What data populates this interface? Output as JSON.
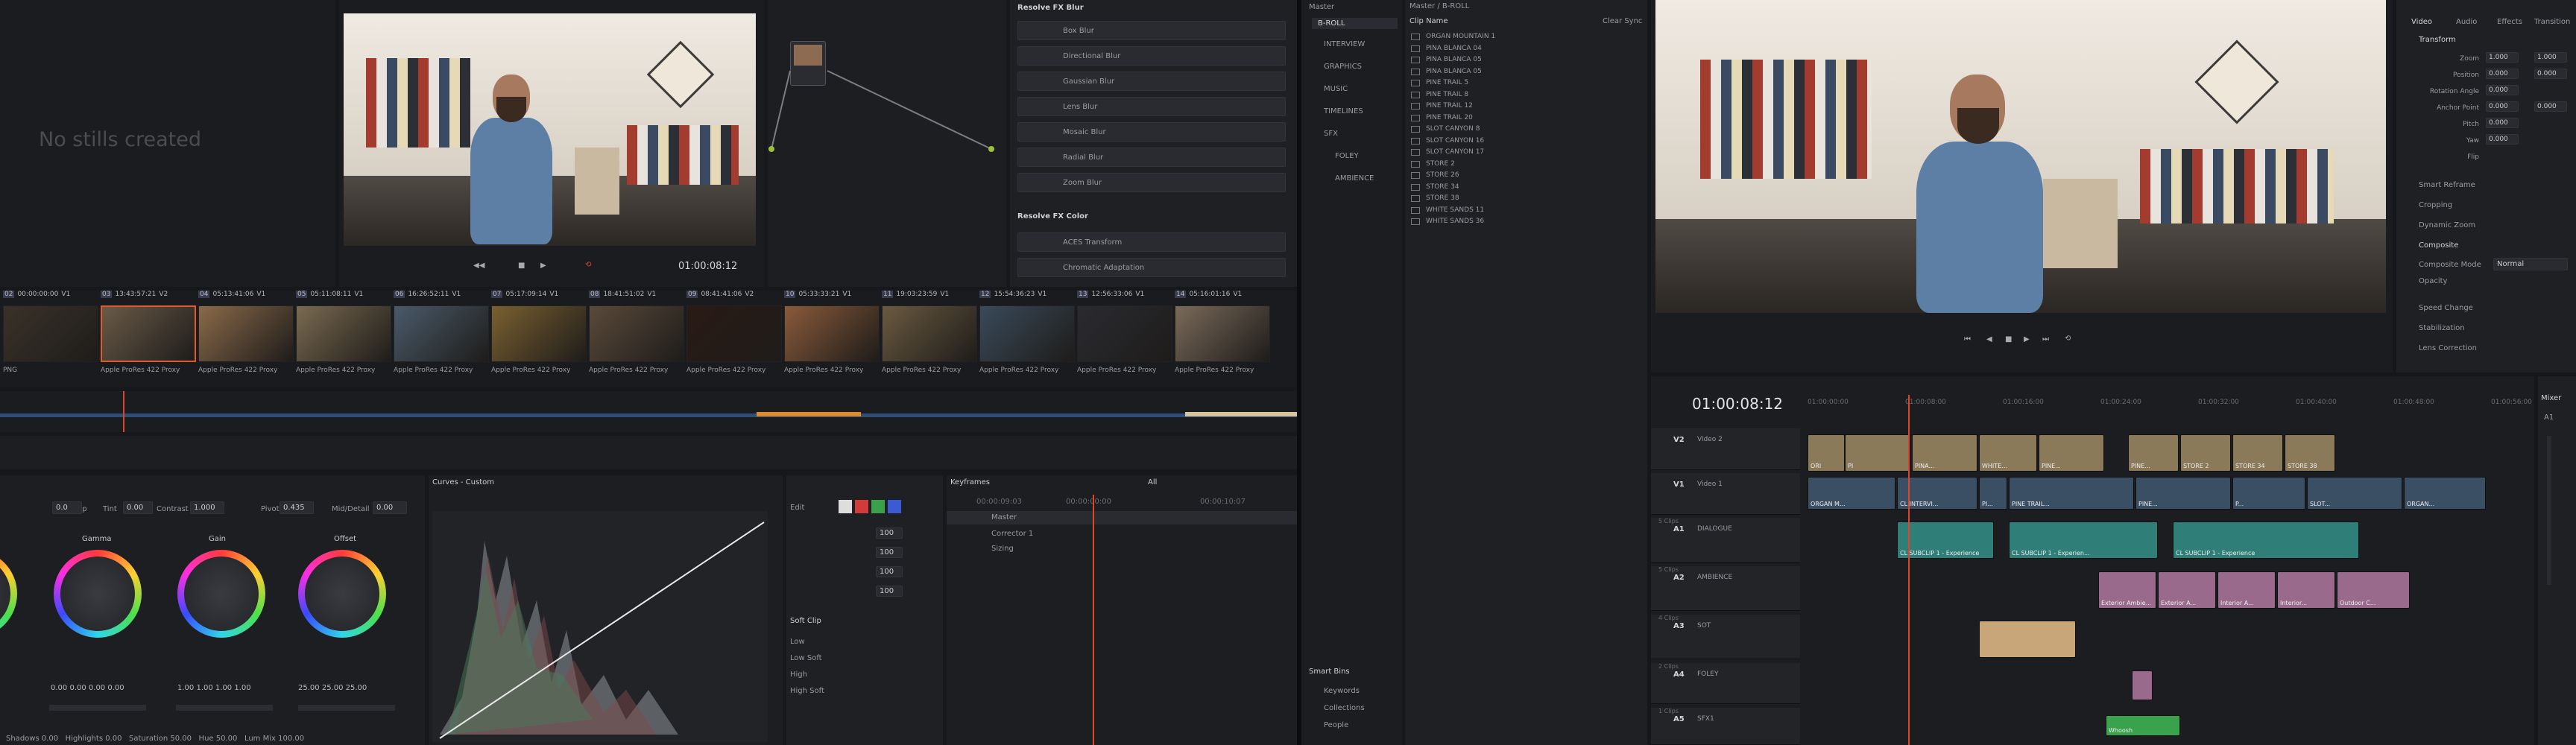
{
  "gallery": {
    "empty_text": "No stills created"
  },
  "color_viewer": {
    "timecode": "01:00:08:12"
  },
  "fx_library": {
    "blur_header": "Resolve FX Blur",
    "blur_items": [
      "Box Blur",
      "Directional Blur",
      "Gaussian Blur",
      "Lens Blur",
      "Mosaic Blur",
      "Radial Blur",
      "Zoom Blur"
    ],
    "color_header": "Resolve FX Color",
    "color_items": [
      "ACES Transform",
      "Chromatic Adaptation"
    ]
  },
  "clips_strip": {
    "clips": [
      {
        "num": "02",
        "tc": "00:00:00:00",
        "name": "PNG",
        "track": "V1"
      },
      {
        "num": "03",
        "tc": "13:43:57:21",
        "name": "Apple ProRes 422 Proxy",
        "track": "V2"
      },
      {
        "num": "04",
        "tc": "05:13:41:06",
        "name": "Apple ProRes 422 Proxy",
        "track": "V1"
      },
      {
        "num": "05",
        "tc": "05:11:08:11",
        "name": "Apple ProRes 422 Proxy",
        "track": "V1"
      },
      {
        "num": "06",
        "tc": "16:26:52:11",
        "name": "Apple ProRes 422 Proxy",
        "track": "V1"
      },
      {
        "num": "07",
        "tc": "05:17:09:14",
        "name": "Apple ProRes 422 Proxy",
        "track": "V1"
      },
      {
        "num": "08",
        "tc": "18:41:51:02",
        "name": "Apple ProRes 422 Proxy",
        "track": "V1"
      },
      {
        "num": "09",
        "tc": "08:41:41:06",
        "name": "Apple ProRes 422 Proxy",
        "track": "V2"
      },
      {
        "num": "10",
        "tc": "05:33:33:21",
        "name": "Apple ProRes 422 Proxy",
        "track": "V1"
      },
      {
        "num": "11",
        "tc": "19:03:23:59",
        "name": "Apple ProRes 422 Proxy",
        "track": "V1"
      },
      {
        "num": "12",
        "tc": "15:54:36:23",
        "name": "Apple ProRes 422 Proxy",
        "track": "V1"
      },
      {
        "num": "13",
        "tc": "12:56:33:06",
        "name": "Apple ProRes 422 Proxy",
        "track": "V1"
      },
      {
        "num": "14",
        "tc": "05:16:01:16",
        "name": "Apple ProRes 422 Proxy",
        "track": "V1"
      }
    ]
  },
  "primaries": {
    "temp_label": "Temp",
    "temp_val": "0.0",
    "tint_label": "Tint",
    "tint_val": "0.00",
    "contrast_label": "Contrast",
    "contrast_val": "1.000",
    "pivot_label": "Pivot",
    "pivot_val": "0.435",
    "middetail_label": "Mid/Detail",
    "middetail_val": "0.00",
    "wheels": [
      {
        "name": "Gamma",
        "values": [
          "0.00",
          "0.00",
          "0.00",
          "0.00"
        ]
      },
      {
        "name": "Gain",
        "values": [
          "1.00",
          "1.00",
          "1.00",
          "1.00"
        ]
      },
      {
        "name": "Offset",
        "values": [
          "25.00",
          "25.00",
          "25.00"
        ]
      }
    ],
    "bottom": {
      "shadows_label": "Shadows",
      "shadows_val": "0.00",
      "highlights_label": "Highlights",
      "highlights_val": "0.00",
      "saturation_label": "Saturation",
      "saturation_val": "50.00",
      "hue_label": "Hue",
      "hue_val": "50.00",
      "lummix_label": "Lum Mix",
      "lummix_val": "100.00"
    }
  },
  "curves": {
    "title": "Curves - Custom"
  },
  "curve_edit": {
    "label": "Edit",
    "values": [
      "100",
      "100",
      "100",
      "100"
    ],
    "softclip_label": "Soft Clip",
    "softclip_items": [
      "Low",
      "Low Soft",
      "High",
      "High Soft"
    ]
  },
  "keyframes": {
    "title": "Keyframes",
    "filter": "All",
    "tc_left": "00:00:09:03",
    "tc_mid": "00:00:00:00",
    "tc_right": "00:00:10:07",
    "rows": [
      "Master",
      "Corrector 1",
      "Sizing"
    ]
  },
  "media_pool": {
    "root": "Master",
    "bins": [
      "B-ROLL",
      "INTERVIEW",
      "GRAPHICS",
      "MUSIC",
      "TIMELINES",
      "SFX",
      "FOLEY",
      "AMBIENCE"
    ],
    "path": "Master / B-ROLL",
    "column_header": "Clip Name",
    "sort_label": "Clear Sync",
    "clips": [
      "ORGAN MOUNTAIN 1",
      "PINA BLANCA 04",
      "PINA BLANCA 05",
      "PINA BLANCA 05",
      "PINE TRAIL 5",
      "PINE TRAIL 8",
      "PINE TRAIL 12",
      "PINE TRAIL 20",
      "SLOT CANYON 8",
      "SLOT CANYON 16",
      "SLOT CANYON 17",
      "STORE 2",
      "STORE 26",
      "STORE 34",
      "STORE 38",
      "WHITE SANDS 11",
      "WHITE SANDS 36"
    ],
    "smart_bins_title": "Smart Bins",
    "smart_bins": [
      "Keywords",
      "Collections",
      "People"
    ]
  },
  "edit_timeline": {
    "timecode": "01:00:08:12",
    "ruler": [
      "01:00:00:00",
      "01:00:08:00",
      "01:00:16:00",
      "01:00:24:00",
      "01:00:32:00",
      "01:00:40:00",
      "01:00:48:00",
      "01:00:56:00"
    ],
    "tracks": [
      {
        "id": "V2",
        "name": "Video 2",
        "clips_label": ""
      },
      {
        "id": "V1",
        "name": "Video 1",
        "clips_label": ""
      },
      {
        "id": "A1",
        "name": "DIALOGUE",
        "clips_label": "5 Clips"
      },
      {
        "id": "A2",
        "name": "AMBIENCE",
        "clips_label": "5 Clips"
      },
      {
        "id": "A3",
        "name": "SOT",
        "clips_label": "4 Clips"
      },
      {
        "id": "A4",
        "name": "FOLEY",
        "clips_label": "2 Clips"
      },
      {
        "id": "A5",
        "name": "SFX1",
        "clips_label": "1 Clips"
      }
    ],
    "v2_clips": [
      "ORI",
      "PI",
      "PINA...",
      "WHITE...",
      "PINE...",
      "PINE...",
      "STORE 2",
      "STORE 34",
      "STORE 38"
    ],
    "v1_clips": [
      "ORGAN M...",
      "CL INTERVI...",
      "PI...",
      "PINE TRAIL...",
      "PINE...",
      "P...",
      "SLOT...",
      "ORGAN..."
    ],
    "a1_clips": [
      "CL SUBCLIP 1 - Experience",
      "CL SUBCLIP 1 - Experien...",
      "CL SUBCLIP 1 - Experience"
    ],
    "a2_clips": [
      "Exterior Ambie...",
      "Exterior A...",
      "Interior A...",
      "Interior...",
      "Outdoor C..."
    ],
    "a5_clips": [
      "Whoosh"
    ]
  },
  "inspector": {
    "tabs": [
      "Video",
      "Audio",
      "Effects",
      "Transition"
    ],
    "transform_title": "Transform",
    "rows": [
      {
        "label": "Zoom",
        "x": "1.000",
        "y": "1.000"
      },
      {
        "label": "Position",
        "x": "0.000",
        "y": "0.000"
      },
      {
        "label": "Rotation Angle",
        "x": "0.000",
        "y": ""
      },
      {
        "label": "Anchor Point",
        "x": "0.000",
        "y": "0.000"
      },
      {
        "label": "Pitch",
        "x": "0.000",
        "y": ""
      },
      {
        "label": "Yaw",
        "x": "0.000",
        "y": ""
      },
      {
        "label": "Flip",
        "x": "",
        "y": ""
      }
    ],
    "sections": [
      "Smart Reframe",
      "Cropping",
      "Dynamic Zoom",
      "Composite"
    ],
    "composite_mode_label": "Composite Mode",
    "composite_mode_val": "Normal",
    "opacity_label": "Opacity",
    "sections2": [
      "Speed Change",
      "Stabilization",
      "Lens Correction"
    ]
  },
  "mixer": {
    "title": "Mixer",
    "channel": "A1"
  },
  "colors": {
    "accent": "#e05a2f",
    "v2_clip": "#8a7a5a",
    "a1_clip": "#2f7e78",
    "a2_clip": "#9a6a8c",
    "a3_clip": "#c9a57a",
    "a5_clip": "#39a24c",
    "playhead": "#e0442a"
  }
}
